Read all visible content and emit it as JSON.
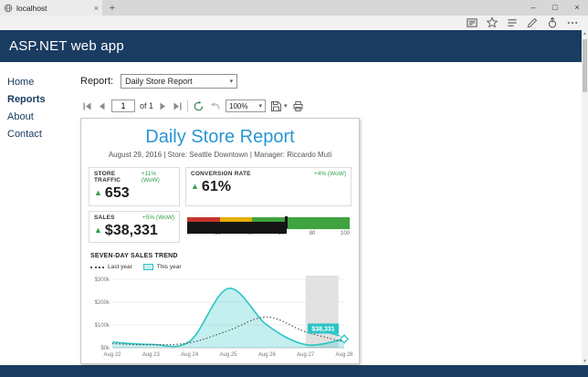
{
  "browser": {
    "tab_title": "localhost",
    "tab_close_glyph": "×",
    "new_tab_glyph": "+",
    "window_controls": {
      "minimize": "–",
      "maximize": "□",
      "close": "×"
    }
  },
  "header": {
    "title": "ASP.NET web app"
  },
  "sidebar": {
    "items": [
      {
        "label": "Home"
      },
      {
        "label": "Reports"
      },
      {
        "label": "About"
      },
      {
        "label": "Contact"
      }
    ]
  },
  "report_bar": {
    "label": "Report:",
    "selected_report": "Daily Store Report"
  },
  "viewer_toolbar": {
    "page_number": "1",
    "page_count_label": "of 1",
    "zoom_value": "100%"
  },
  "report": {
    "title": "Daily Store Report",
    "meta": "August 29, 2016 | Store: Seattle Downtown | Manager: Riccardo Muti",
    "kpis": [
      {
        "label": "STORE TRAFFIC",
        "delta": "+11% (WoW)",
        "arrow": "▲",
        "value": "653"
      },
      {
        "label": "CONVERSION RATE",
        "delta": "+4% (WoW)",
        "arrow": "▲",
        "value": "61%"
      },
      {
        "label": "SALES",
        "delta": "+5% (WoW)",
        "arrow": "▲",
        "value": "$38,331"
      }
    ],
    "trend": {
      "title": "SEVEN-DAY SALES TREND",
      "legend": [
        {
          "label": "Last year"
        },
        {
          "label": "This year"
        }
      ]
    }
  },
  "icons": {
    "caret_down": "▾"
  },
  "colors": {
    "header_navy": "#1a3c61",
    "title_blue": "#2a96d4",
    "positive_green": "#2f9e44",
    "teal": "#2cc4c4",
    "bullet_red": "#c5352c",
    "bullet_yellow": "#e2ae05",
    "bullet_green": "#3fa33f",
    "band_gray": "#e1e1e1"
  },
  "chart_data": [
    {
      "type": "area",
      "title": "SEVEN-DAY SALES TREND",
      "categories": [
        "Aug 22",
        "Aug 23",
        "Aug 24",
        "Aug 25",
        "Aug 26",
        "Aug 27",
        "Aug 28"
      ],
      "series": [
        {
          "name": "Last year",
          "style": "dotted",
          "color": "#4a4a4a",
          "values": [
            18,
            13,
            22,
            75,
            135,
            70,
            26
          ]
        },
        {
          "name": "This year",
          "style": "area",
          "color": "#2cc4c4",
          "values": [
            25,
            15,
            28,
            260,
            100,
            14,
            38.331
          ]
        }
      ],
      "ylim": [
        0,
        300
      ],
      "y_ticks": [
        "$0k",
        "$100k",
        "$200k",
        "$300k"
      ],
      "grid": true,
      "legend_position": "top-left",
      "highlight_band": {
        "from_index": 5,
        "to_index": 5.85,
        "color": "#e1e1e1"
      },
      "callout": {
        "text": "$38,331",
        "series": "This year",
        "index": 6
      }
    },
    {
      "type": "bullet",
      "title": "CONVERSION RATE",
      "xlim": [
        0,
        100
      ],
      "ticks": [
        "0",
        "20",
        "40",
        "60",
        "80",
        "100"
      ],
      "ranges": [
        {
          "to": 20,
          "color": "#c5352c"
        },
        {
          "to": 40,
          "color": "#e2ae05"
        },
        {
          "to": 100,
          "color": "#3fa33f"
        }
      ],
      "value": 61,
      "target": 61
    }
  ]
}
